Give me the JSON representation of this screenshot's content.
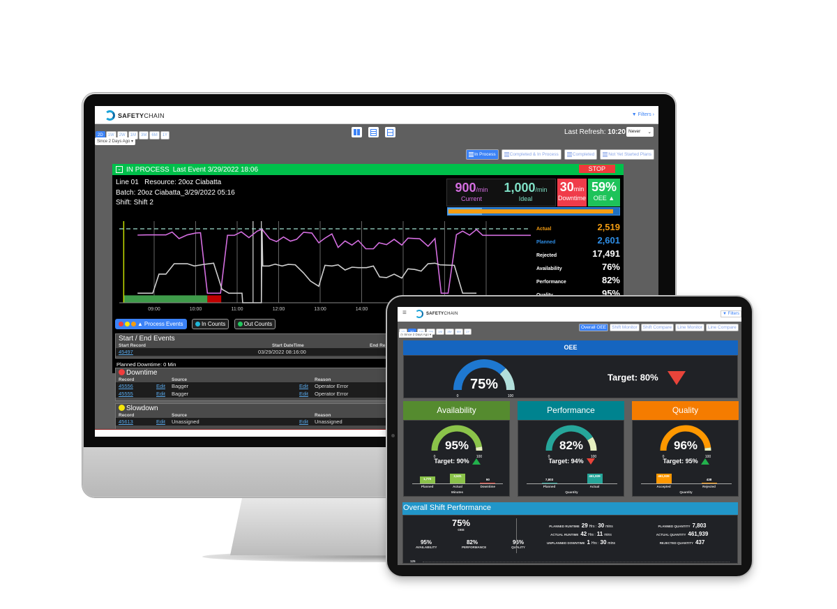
{
  "colors": {
    "accent": "#3b82f6",
    "in_process": "#00c04b",
    "stop": "#ee3b3b",
    "current": "#d46ee0",
    "ideal": "#7fe0c6",
    "actual": "#f39c12",
    "planned": "#2f8fe8",
    "downtime": "#ee3b3b",
    "oee_header": "#1565c0",
    "availability": "#558b2f",
    "performance": "#00838f",
    "quality": "#f57c00",
    "shift_header": "#2196c9"
  },
  "monitor": {
    "brand": {
      "bold": "SAFETY",
      "light": "CHAIN"
    },
    "filters_label": "Filters ›",
    "time_buttons": [
      "2D",
      "1W",
      "2W",
      "1M",
      "3M",
      "6M",
      "1Y"
    ],
    "time_active": "2D",
    "since_label": "Since 2 Days Ago ▾",
    "view_icons": [
      "grid-view-icon",
      "list-view-icon",
      "split-view-icon"
    ],
    "last_refresh_label": "Last Refresh:",
    "last_refresh_time": "10:20",
    "refresh_select": "Never",
    "tabs": [
      "In Process",
      "Completed & In Process",
      "Completed",
      "Not Yet Started Plans"
    ],
    "tab_active": "In Process",
    "status": "IN PROCESS",
    "last_event": "Last Event 3/29/2022 18:06",
    "stop_label": "STOP",
    "line": "Line 01",
    "resource_label": "Resource:",
    "resource": "20oz Ciabatta",
    "batch_label": "Batch:",
    "batch": "20oz Ciabatta_3/29/2022 05:16",
    "shift_label": "Shift:",
    "shift": "Shift 2",
    "kpis": {
      "current": "900",
      "current_unit": "/min",
      "current_label": "Current",
      "ideal": "1,000",
      "ideal_unit": "/min",
      "ideal_label": "Ideal",
      "downtime": "30",
      "downtime_unit": "min",
      "downtime_label": "Downtime",
      "oee": "59%",
      "oee_label": "OEE"
    },
    "progress": {
      "actual_fraction": 0.968,
      "planned_fraction": 0.2
    },
    "stats": [
      {
        "label": "Actual",
        "value": "2,519",
        "color": "#f39c12"
      },
      {
        "label": "Planned",
        "value": "2,601",
        "color": "#2f8fe8"
      },
      {
        "label": "Rejected",
        "value": "17,491",
        "color": "#ffffff"
      },
      {
        "label": "Availability",
        "value": "76%",
        "color": "#ffffff"
      },
      {
        "label": "Performance",
        "value": "82%",
        "color": "#ffffff"
      },
      {
        "label": "Quality",
        "value": "95%",
        "color": "#ffffff"
      }
    ],
    "legend": [
      "Process Events",
      "In Counts",
      "Out Counts"
    ],
    "start_end": {
      "title": "Start / End Events",
      "headers": [
        "Start Record",
        "Start DateTime",
        "End Re"
      ],
      "rows": [
        [
          "45497",
          "03/29/2022 08:16:00"
        ]
      ]
    },
    "planned_downtime": "Planned Downtime: 0 Min",
    "downtime": {
      "title": "Downtime",
      "headers": [
        "Record",
        "Source",
        "Reason"
      ],
      "edit": "Edit",
      "rows": [
        [
          "45556",
          "Bagger",
          "Operator Error"
        ],
        [
          "45555",
          "Bagger",
          "Operator Error"
        ]
      ]
    },
    "slowdown": {
      "title": "Slowdown",
      "headers": [
        "Record",
        "Source",
        "Reason"
      ],
      "edit": "Edit",
      "rows": [
        [
          "45613",
          "Unassigned",
          "Unassigned"
        ]
      ]
    }
  },
  "chart_data": {
    "type": "line",
    "x_range": [
      "08:16",
      "18:06"
    ],
    "x_ticks": [
      "09:00",
      "10:00",
      "11:00",
      "12:00",
      "13:00",
      "14:00"
    ],
    "y_range": [
      0,
      1000
    ],
    "ideal_rate": 1000,
    "grid": "vertical hourly",
    "series": [
      {
        "color": "#d46ee0",
        "points": [
          [
            "08:36",
            915
          ],
          [
            "08:50",
            918
          ],
          [
            "09:17",
            918
          ],
          [
            "09:26",
            956
          ],
          [
            "09:36",
            868
          ],
          [
            "09:48",
            918
          ],
          [
            "10:00",
            943
          ],
          [
            "10:07",
            947
          ],
          [
            "10:17",
            129
          ],
          [
            "10:36",
            129
          ],
          [
            "10:46",
            912
          ],
          [
            "10:56",
            912
          ],
          [
            "11:06",
            959
          ],
          [
            "11:17",
            881
          ],
          [
            "11:29",
            969
          ],
          [
            "11:36",
            994
          ],
          [
            "11:47",
            865
          ],
          [
            "11:57",
            827
          ],
          [
            "12:07",
            890
          ],
          [
            "12:17",
            833
          ],
          [
            "12:26",
            858
          ],
          [
            "12:36",
            953
          ],
          [
            "12:48",
            943
          ],
          [
            "12:58",
            811
          ],
          [
            "13:07",
            874
          ],
          [
            "13:17",
            931
          ],
          [
            "13:26",
            748
          ],
          [
            "13:36",
            836
          ],
          [
            "13:46",
            780
          ],
          [
            "13:55",
            843
          ],
          [
            "14:06",
            730
          ],
          [
            "14:17",
            730
          ],
          [
            "14:25",
            811
          ],
          [
            "14:36",
            786
          ],
          [
            "14:47",
            858
          ],
          [
            "14:58",
            780
          ],
          [
            "15:07",
            874
          ],
          [
            "15:24",
            865
          ],
          [
            "15:36",
            764
          ],
          [
            "15:46",
            868
          ],
          [
            "15:55",
            129
          ],
          [
            "16:05",
            129
          ],
          [
            "16:17",
            921
          ],
          [
            "16:26",
            969
          ],
          [
            "16:36",
            915
          ],
          [
            "16:46",
            990
          ],
          [
            "16:55",
            912
          ],
          [
            "18:05",
            912
          ]
        ]
      },
      {
        "color": "#cfcfcf",
        "points": [
          [
            "08:36",
            129
          ],
          [
            "08:58",
            129
          ],
          [
            "09:07",
            387
          ],
          [
            "09:17",
            387
          ],
          [
            "09:29",
            528
          ],
          [
            "09:48",
            528
          ],
          [
            "09:58",
            497
          ],
          [
            "10:12",
            519
          ],
          [
            "10:26",
            535
          ],
          [
            "10:38",
            183
          ],
          [
            "10:48",
            129
          ],
          [
            "11:07",
            129
          ],
          [
            "11:08",
            0
          ],
          [
            "11:35",
            0
          ],
          [
            "11:36",
            994
          ],
          [
            "11:37",
            497
          ],
          [
            "11:46",
            497
          ],
          [
            "11:55",
            522
          ],
          [
            "12:05",
            497
          ],
          [
            "12:14",
            519
          ],
          [
            "12:24",
            513
          ],
          [
            "12:36",
            403
          ],
          [
            "12:46",
            293
          ],
          [
            "12:58",
            223
          ],
          [
            "13:07",
            506
          ],
          [
            "13:17",
            497
          ],
          [
            "13:26",
            513
          ],
          [
            "13:36",
            443
          ],
          [
            "13:46",
            481
          ],
          [
            "13:55",
            475
          ],
          [
            "14:07",
            475
          ],
          [
            "14:17",
            497
          ],
          [
            "14:26",
            349
          ],
          [
            "14:36",
            340
          ],
          [
            "14:47",
            387
          ],
          [
            "14:58",
            334
          ],
          [
            "15:07",
            459
          ],
          [
            "15:17",
            450
          ],
          [
            "15:26",
            428
          ],
          [
            "15:36",
            528
          ],
          [
            "15:46",
            535
          ],
          [
            "15:53",
            513
          ],
          [
            "16:14",
            506
          ],
          [
            "16:26",
            129
          ],
          [
            "16:46",
            129
          ]
        ]
      }
    ],
    "bands": [
      {
        "from": "08:16",
        "to": "10:17",
        "color": "#3f9b4a"
      },
      {
        "from": "10:17",
        "to": "10:37",
        "color": "#c00000"
      },
      {
        "from": "15:55",
        "to": "16:05",
        "color": "#c00000"
      }
    ],
    "event_markers": [
      "11:23",
      "11:35"
    ]
  },
  "tablet": {
    "brand": {
      "bold": "SAFETY",
      "light": "CHAIN"
    },
    "filters_label": "Filters",
    "time_buttons": [
      "1D",
      "2D",
      "1W",
      "2W",
      "1M",
      "3M",
      "6M",
      "1Y"
    ],
    "time_active": "2D",
    "since_label": "Since 2 Days Ago ▾",
    "tabs": [
      "Overall OEE",
      "Shift Monitor",
      "Shift Compare",
      "Line Monitor",
      "Line Compare"
    ],
    "tab_active": "Overall OEE",
    "oee": {
      "title": "OEE",
      "value": 75,
      "value_label": "75%",
      "min": "0",
      "max": "100",
      "target": "Target: 80%",
      "trend": "down"
    },
    "cards": [
      {
        "title": "Availability",
        "value": 95,
        "value_label": "95%",
        "target": "Target: 90%",
        "trend": "up",
        "header": "#558b2f",
        "arc": "#8bc34a",
        "axis": "Minutes",
        "bars": [
          {
            "label": "Planned",
            "value": 1770,
            "text": "1,770"
          },
          {
            "label": "Actual",
            "value": 2531,
            "text": "2,531"
          },
          {
            "label": "Downtime",
            "value": 90,
            "text": "90"
          }
        ]
      },
      {
        "title": "Performance",
        "value": 82,
        "value_label": "82%",
        "target": "Target: 94%",
        "trend": "down",
        "header": "#00838f",
        "arc": "#26a69a",
        "axis": "Quantity",
        "bars": [
          {
            "label": "Planned",
            "value": 7803,
            "text": "7,803"
          },
          {
            "label": "Actual",
            "value": 461939,
            "text": "461,939"
          }
        ]
      },
      {
        "title": "Quality",
        "value": 96,
        "value_label": "96%",
        "target": "Target: 95%",
        "trend": "up",
        "header": "#f57c00",
        "arc": "#ff9800",
        "axis": "Quantity",
        "bars": [
          {
            "label": "Accepted",
            "value": 461939,
            "text": "461,939"
          },
          {
            "label": "Rejected",
            "value": 438,
            "text": "438"
          }
        ]
      }
    ],
    "gauge_min": "0",
    "gauge_max": "100",
    "shift": {
      "title": "Overall Shift Performance",
      "oee": "75%",
      "oee_label": "OEE",
      "parts": [
        {
          "v": "95%",
          "l": "AVAILABILITY"
        },
        {
          "v": "82%",
          "l": "PERFORMANCE"
        },
        {
          "v": "96%",
          "l": "QUALITY"
        }
      ],
      "runtime": [
        {
          "l": "PLANNED RUNTIME",
          "h": "29",
          "m": "30"
        },
        {
          "l": "ACTUAL RUNTIME",
          "h": "42",
          "m": "11"
        },
        {
          "l": "UNPLANNED DOWNTIME",
          "h": "1",
          "m": "30"
        }
      ],
      "hrs": "Hrs :",
      "mins": "mins",
      "quantity": [
        {
          "l": "PLANNED QUANTITY",
          "v": "7,803"
        },
        {
          "l": "ACTUAL QUANTITY",
          "v": "461,939"
        },
        {
          "l": "REJECTED QUANTITY",
          "v": "437"
        }
      ],
      "axis_top": "125"
    }
  }
}
